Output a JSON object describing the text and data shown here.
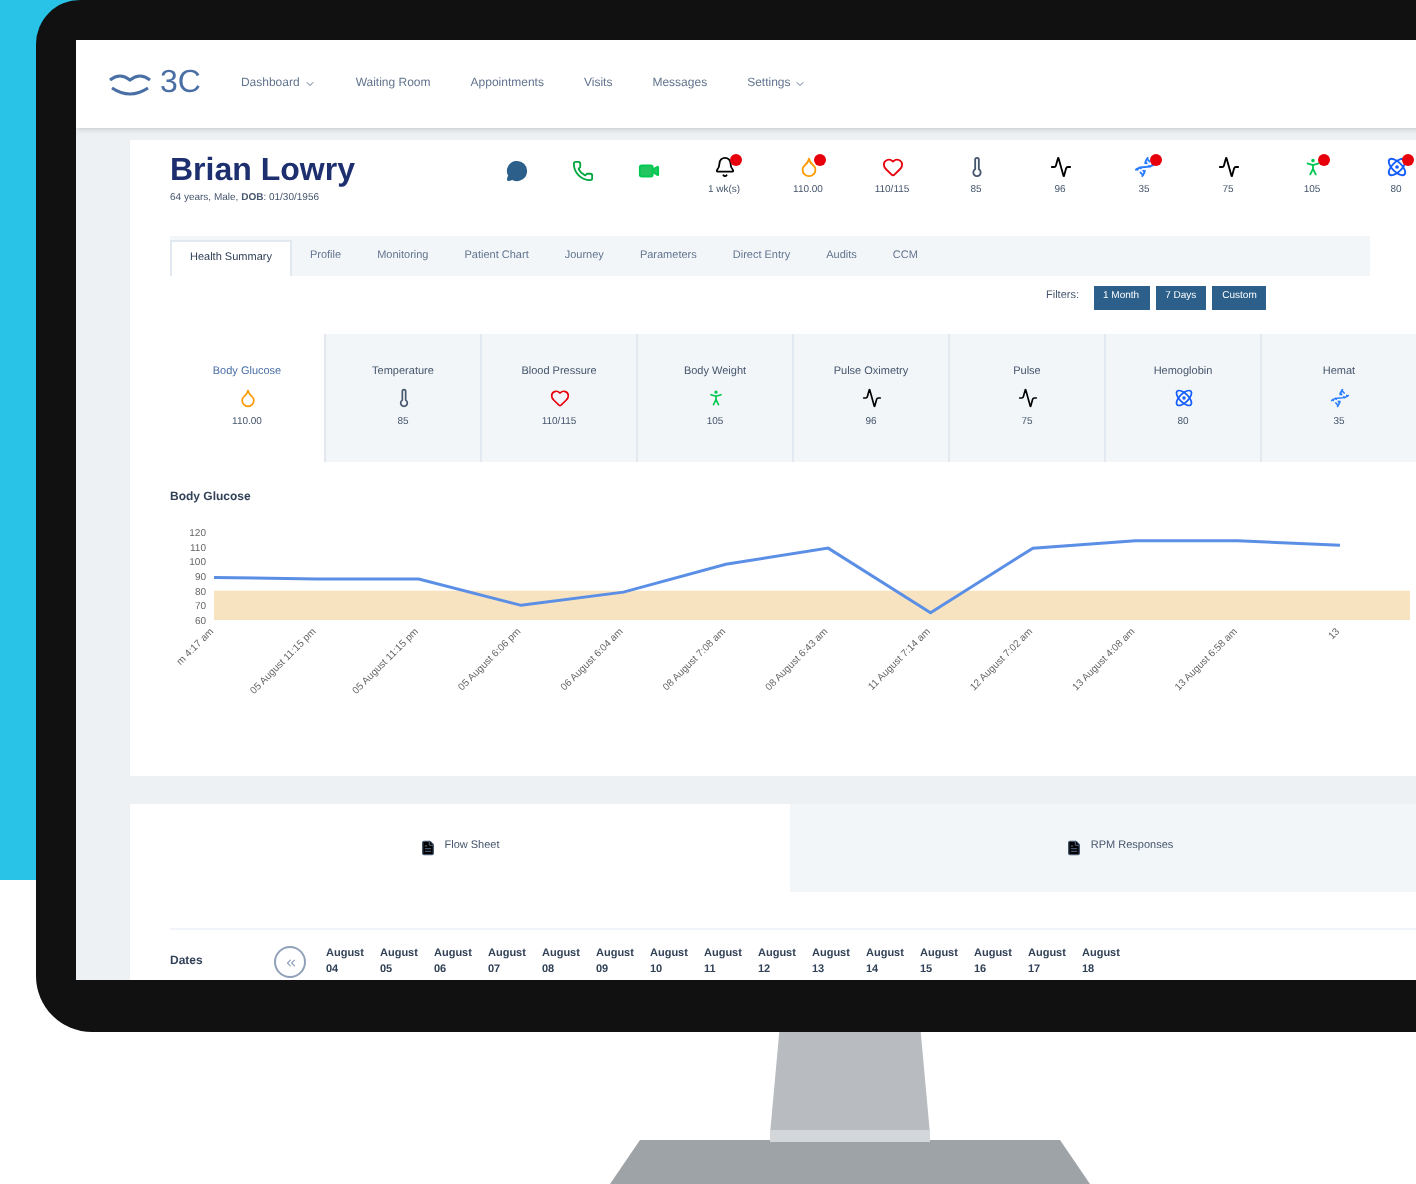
{
  "nav": {
    "logo": "3C",
    "items": [
      {
        "label": "Dashboard",
        "dropdown": true
      },
      {
        "label": "Waiting Room",
        "dropdown": false
      },
      {
        "label": "Appointments",
        "dropdown": false
      },
      {
        "label": "Visits",
        "dropdown": false
      },
      {
        "label": "Messages",
        "dropdown": false
      },
      {
        "label": "Settings",
        "dropdown": true
      }
    ]
  },
  "patient": {
    "name": "Brian Lowry",
    "details": "64 years, Male, **DOB**: 01/30/1956"
  },
  "vitals": [
    {
      "value": "1 wk(s)",
      "alert": true
    },
    {
      "value": "110.00",
      "alert": true
    },
    {
      "value": "110/115",
      "alert": false
    },
    {
      "value": "85",
      "alert": false
    },
    {
      "value": "96",
      "alert": false
    },
    {
      "value": "35",
      "alert": true
    },
    {
      "value": "75",
      "alert": false
    },
    {
      "value": "105",
      "alert": true
    },
    {
      "value": "80",
      "alert": true
    }
  ],
  "tabs": [
    {
      "label": "Health Summary",
      "selected": true
    },
    {
      "label": "Profile",
      "selected": false
    },
    {
      "label": "Monitoring",
      "selected": false
    },
    {
      "label": "Patient Chart",
      "selected": false
    },
    {
      "label": "Journey",
      "selected": false
    },
    {
      "label": "Parameters",
      "selected": false
    },
    {
      "label": "Direct Entry",
      "selected": false
    },
    {
      "label": "Audits",
      "selected": false
    },
    {
      "label": "CCM",
      "selected": false
    }
  ],
  "filters": {
    "label": "Filters:",
    "buttons": [
      "1 Month",
      "7 Days",
      "Custom"
    ]
  },
  "metrics": [
    {
      "label": "Body Glucose",
      "value": "110.00",
      "selected": true
    },
    {
      "label": "Temperature",
      "value": "85",
      "selected": false
    },
    {
      "label": "Blood Pressure",
      "value": "110/115",
      "selected": false
    },
    {
      "label": "Body Weight",
      "value": "105",
      "selected": false
    },
    {
      "label": "Pulse Oximetry",
      "value": "96",
      "selected": false
    },
    {
      "label": "Pulse",
      "value": "75",
      "selected": false
    },
    {
      "label": "Hemoglobin",
      "value": "80",
      "selected": false
    },
    {
      "label": "Hemat",
      "value": "35",
      "selected": false
    }
  ],
  "chart": {
    "title": "Body Glucose",
    "chart_data": {
      "type": "line",
      "categories": [
        "m 4:17 am",
        "05 August 11:15 pm",
        "05 August 11:15 pm",
        "05 August 6:06 pm",
        "06 August 6:04 am",
        "08 August 7:08 am",
        "08 August 6:43 am",
        "11 August 7:14 am",
        "12 August 7:02 am",
        "13 August 4:08 am",
        "13 August 6:58 am",
        "13"
      ],
      "series": [
        {
          "color": "#5b8fe6",
          "values": [
            89,
            88,
            88,
            70,
            79,
            98,
            109,
            65,
            109,
            114,
            114,
            111
          ]
        }
      ],
      "yticks": [
        60,
        70,
        80,
        90,
        100,
        110,
        120
      ],
      "ylim": [
        60,
        120
      ],
      "bands": [
        {
          "axis": "y",
          "from": 60,
          "to": 80,
          "color": "#f8e3c0"
        }
      ]
    }
  },
  "sheet_tabs": [
    {
      "label": "Flow Sheet",
      "selected": true
    },
    {
      "label": "RPM Responses",
      "selected": false
    }
  ],
  "dates": {
    "label": "Dates",
    "items": [
      "August 04",
      "August 05",
      "August 06",
      "August 07",
      "August 08",
      "August 09",
      "August 10",
      "August 11",
      "August 12",
      "August 13",
      "August 14",
      "August 15",
      "August 16",
      "August 17",
      "August 18"
    ]
  }
}
